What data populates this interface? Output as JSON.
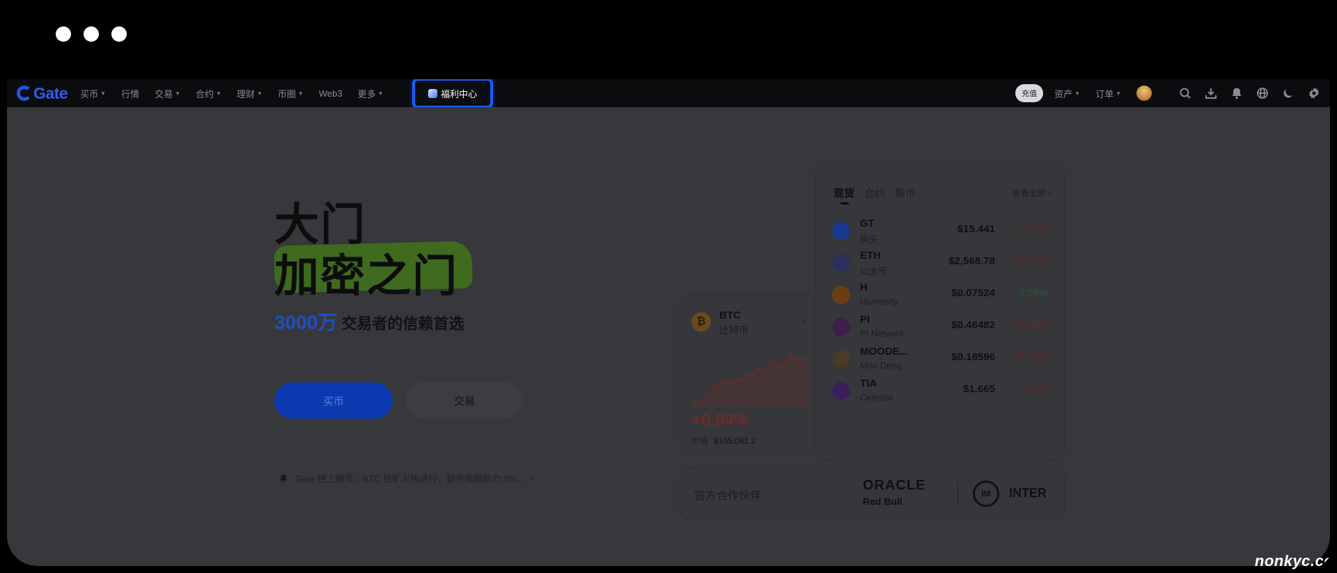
{
  "nav": {
    "logo": "Gate",
    "items": [
      {
        "label": "买币",
        "caret": true
      },
      {
        "label": "行情",
        "caret": false
      },
      {
        "label": "交易",
        "caret": true
      },
      {
        "label": "合约",
        "caret": true
      },
      {
        "label": "理财",
        "caret": true
      },
      {
        "label": "币圈",
        "caret": true
      },
      {
        "label": "Web3",
        "caret": false
      },
      {
        "label": "更多",
        "caret": true
      }
    ],
    "welfare_label": "福利中心",
    "deposit_label": "充值",
    "assets_label": "资产",
    "orders_label": "订单",
    "icons": [
      "search-icon",
      "download-icon",
      "bell-icon",
      "globe-icon",
      "moon-icon",
      "gear-icon"
    ]
  },
  "hero": {
    "title_line1": "大门",
    "title_line2": "加密之门",
    "sub_number": "3000万",
    "sub_text": "交易者的信赖首选",
    "buy_label": "买币",
    "trade_label": "交易",
    "notice": "Gate 链上赚币：BTC 挖矿火热进行，额外奖励助力 3%..."
  },
  "btc_card": {
    "symbol": "BTC",
    "name": "比特币",
    "change": "+0.99%",
    "price_label": "价值",
    "price": "$105,081.2",
    "sparkline": [
      12,
      10,
      14,
      13,
      22,
      30,
      28,
      35,
      33,
      31,
      36,
      34,
      40,
      38,
      48,
      45,
      43,
      55,
      52,
      48,
      52,
      60,
      58,
      50,
      57,
      55
    ]
  },
  "market": {
    "tabs": [
      "现货",
      "合约",
      "新币"
    ],
    "active_tab": 0,
    "view_all": "查看全部 ›",
    "rows": [
      {
        "symbol": "GT",
        "name": "狗头",
        "price": "$15.441",
        "change": "+1.91%",
        "dir": "up",
        "color": "#1b3a8f"
      },
      {
        "symbol": "ETH",
        "name": "以太币",
        "price": "$2,568.78",
        "change": "+2.32%",
        "dir": "up",
        "color": "#2c2f5a"
      },
      {
        "symbol": "H",
        "name": "Humanity",
        "price": "$0.07524",
        "change": "-2.09%",
        "dir": "down",
        "color": "#6a3e12"
      },
      {
        "symbol": "PI",
        "name": "PI Network",
        "price": "$0.46482",
        "change": "+3.63%",
        "dir": "up",
        "color": "#3f1f4a"
      },
      {
        "symbol": "MOODE...",
        "name": "Moo Deng",
        "price": "$0.18596",
        "change": "+4.74%",
        "dir": "up",
        "color": "#4a3a2a"
      },
      {
        "symbol": "TIA",
        "name": "Celestia",
        "price": "$1.665",
        "change": "+13%",
        "dir": "up",
        "color": "#3a1f5c"
      }
    ]
  },
  "partners": {
    "label": "官方合作伙伴",
    "oracle": "ORACLE",
    "redbull": "Red Bull",
    "inter": "INTER"
  },
  "watermark": "nonkyc.cc"
}
